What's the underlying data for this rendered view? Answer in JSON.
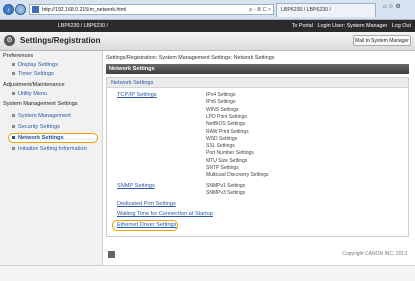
{
  "browser": {
    "url": "http://192.168.0.215/m_network.html",
    "tab_title": "LBP6230 / LBP6230 /",
    "addr_controls": "ρ - ≣ C ×",
    "win_controls": "⌂ ☆ ⚙"
  },
  "banner": {
    "device": "LBP6230 / LBP6230 /",
    "portal": "To Portal",
    "login": "Login User: System Manager",
    "logout": "Log Out"
  },
  "title": {
    "text": "Settings/Registration",
    "mail_button": "Mail to System Manager"
  },
  "sidebar": {
    "sections": [
      {
        "label": "Preferences",
        "items": [
          "Display Settings",
          "Timer Settings"
        ]
      },
      {
        "label": "Adjustment/Maintenance",
        "items": [
          "Utility Menu"
        ]
      },
      {
        "label": "System Management Settings",
        "items": [
          "System Management",
          "Security Settings",
          "Network Settings",
          "Initialize Setting Information"
        ]
      }
    ]
  },
  "main": {
    "breadcrumb": "Settings/Registration: System Management Settings: Network Settings",
    "header": "Network Settings",
    "panel_header": "Network Settings",
    "tcpip_link": "TCP/IP Settings",
    "tcpip_items": [
      "IPv4 Settings",
      "IPv6 Settings",
      "WINS Settings",
      "LPD Print Settings",
      "NetBIOS Settings",
      "RAW Print Settings",
      "WSD Settings",
      "SSL Settings",
      "Port Number Settings",
      "MTU Size Settings",
      "SNTP Settings",
      "Multicast Discovery Settings"
    ],
    "snmp_link": "SNMP Settings",
    "snmp_items": [
      "SNMPv1 Settings",
      "SNMPv3 Settings"
    ],
    "dedicated_port_link": "Dedicated Port Settings",
    "waiting_time_link": "Waiting Time for Connection at Startup",
    "ethernet_link": "Ethernet Driver Settings",
    "copyright": "Copyright CANON INC. 2013"
  }
}
